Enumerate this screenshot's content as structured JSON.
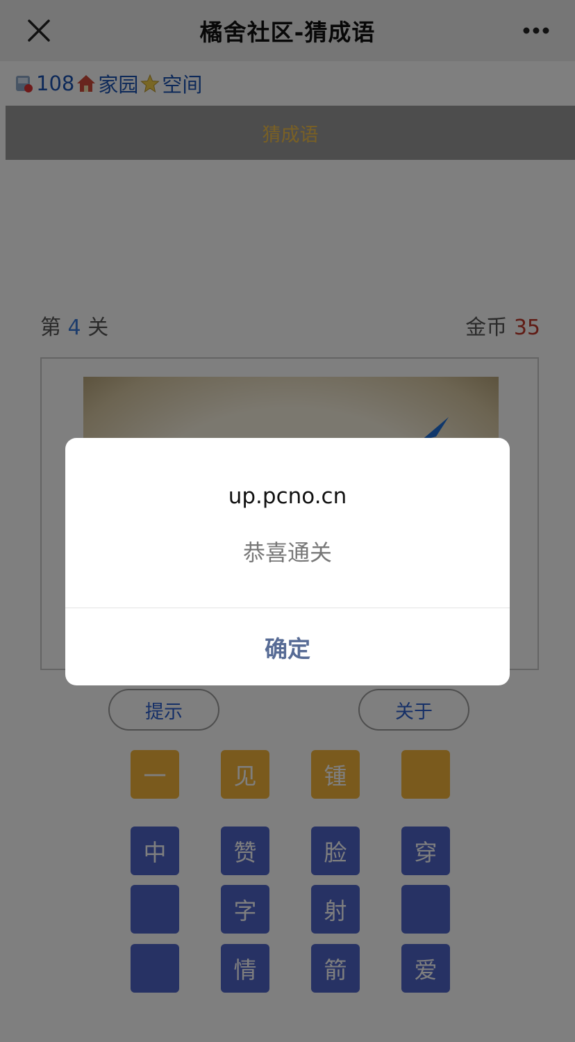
{
  "titlebar": {
    "title": "橘舍社区-猜成语"
  },
  "infobar": {
    "count": "108",
    "home_label": "家园",
    "space_label": "空间"
  },
  "navbar": {
    "label": "猜成语"
  },
  "game": {
    "level_prefix": "第",
    "level_num": "4",
    "level_suffix": "关",
    "coins_label": "金币",
    "coins_value": "35",
    "hint_label": "提示",
    "about_label": "关于",
    "answer_tiles": [
      "一",
      "见",
      "锺",
      ""
    ],
    "option_tiles": [
      "中",
      "赞",
      "脸",
      "穿",
      "",
      "字",
      "射",
      "",
      "",
      "情",
      "箭",
      "爱"
    ]
  },
  "dialog": {
    "host": "up.pcno.cn",
    "message": "恭喜通关",
    "ok_label": "确定"
  },
  "colors": {
    "answer_tile": "#f4b53a",
    "option_tile": "#4e64c8",
    "link_blue": "#1a52b3",
    "dialog_ok": "#576b95"
  }
}
